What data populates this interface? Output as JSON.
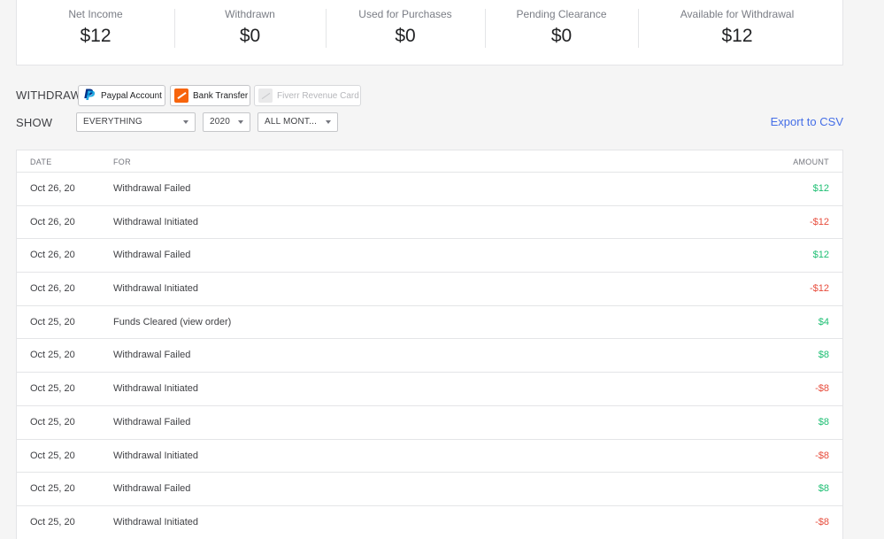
{
  "stats": [
    {
      "label": "Net Income",
      "value": "$12"
    },
    {
      "label": "Withdrawn",
      "value": "$0"
    },
    {
      "label": "Used for Purchases",
      "value": "$0"
    },
    {
      "label": "Pending Clearance",
      "value": "$0"
    },
    {
      "label": "Available for Withdrawal",
      "value": "$12"
    }
  ],
  "withdraw": {
    "label": "WITHDRAW",
    "paypal": "Paypal Account",
    "bank": "Bank Transfer",
    "card": "Fiverr Revenue Card"
  },
  "filters": {
    "label": "SHOW",
    "type": "EVERYTHING",
    "year": "2020",
    "month": "ALL MONT..."
  },
  "export_label": "Export to CSV",
  "colors": {
    "positive": "#1dbf73",
    "negative": "#e74c3c",
    "link": "#446ee7"
  },
  "table": {
    "headers": {
      "date": "DATE",
      "for": "FOR",
      "amount": "AMOUNT"
    },
    "rows": [
      {
        "date": "Oct 26, 20",
        "for": "Withdrawal Failed",
        "amount": "$12",
        "sign": "pos"
      },
      {
        "date": "Oct 26, 20",
        "for": "Withdrawal Initiated",
        "amount": "-$12",
        "sign": "neg"
      },
      {
        "date": "Oct 26, 20",
        "for": "Withdrawal Failed",
        "amount": "$12",
        "sign": "pos"
      },
      {
        "date": "Oct 26, 20",
        "for": "Withdrawal Initiated",
        "amount": "-$12",
        "sign": "neg"
      },
      {
        "date": "Oct 25, 20",
        "for": "Funds Cleared (view order)",
        "amount": "$4",
        "sign": "pos"
      },
      {
        "date": "Oct 25, 20",
        "for": "Withdrawal Failed",
        "amount": "$8",
        "sign": "pos"
      },
      {
        "date": "Oct 25, 20",
        "for": "Withdrawal Initiated",
        "amount": "-$8",
        "sign": "neg"
      },
      {
        "date": "Oct 25, 20",
        "for": "Withdrawal Failed",
        "amount": "$8",
        "sign": "pos"
      },
      {
        "date": "Oct 25, 20",
        "for": "Withdrawal Initiated",
        "amount": "-$8",
        "sign": "neg"
      },
      {
        "date": "Oct 25, 20",
        "for": "Withdrawal Failed",
        "amount": "$8",
        "sign": "pos"
      },
      {
        "date": "Oct 25, 20",
        "for": "Withdrawal Initiated",
        "amount": "-$8",
        "sign": "neg"
      }
    ]
  }
}
